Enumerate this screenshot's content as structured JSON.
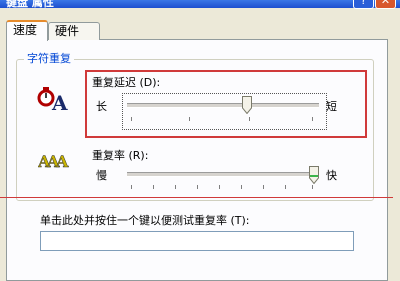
{
  "window": {
    "title": "键盘 属性"
  },
  "tabs": [
    {
      "label": "速度",
      "active": true
    },
    {
      "label": "硬件",
      "active": false
    }
  ],
  "group": {
    "title": "字符重复"
  },
  "repeat_delay": {
    "label": "重复延迟 (D):",
    "min_label": "长",
    "max_label": "短",
    "value": 0.63
  },
  "repeat_rate": {
    "label": "重复率 (R):",
    "min_label": "慢",
    "max_label": "快",
    "value": 1.0
  },
  "test": {
    "label": "单击此处并按住一个键以便测试重复率 (T):",
    "value": ""
  },
  "colors": {
    "accent": "#0046d5",
    "highlight": "#d03a3a"
  },
  "icons": {
    "delay": "stopwatch-letter-icon",
    "rate": "repeated-letters-icon"
  }
}
